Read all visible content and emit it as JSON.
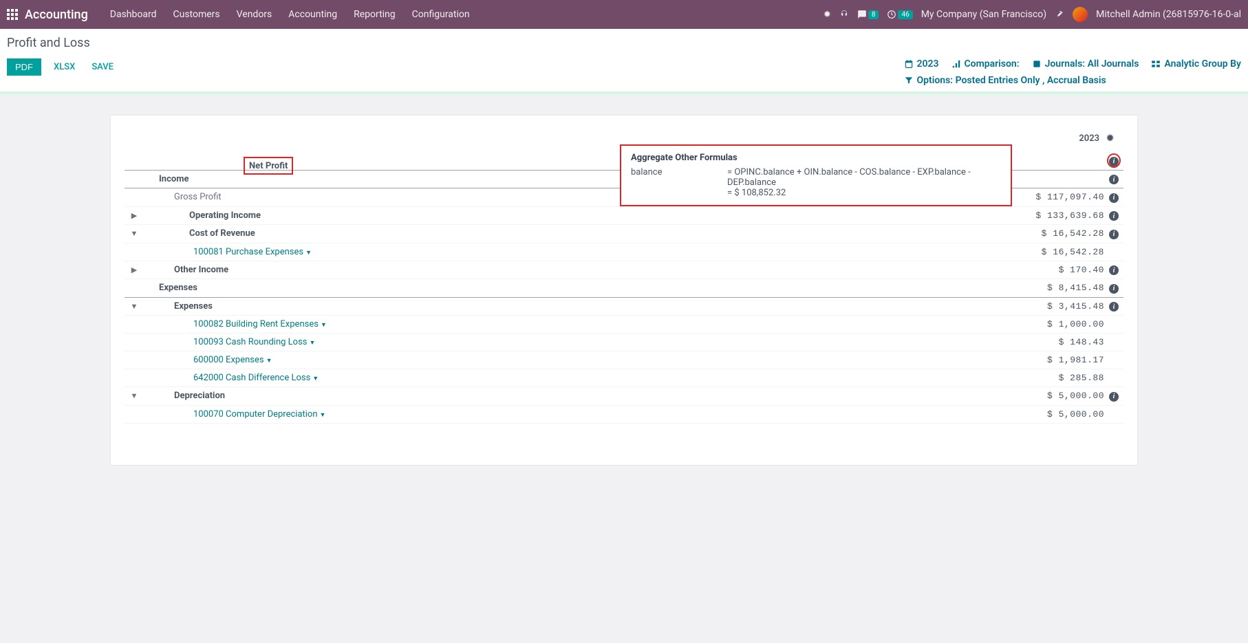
{
  "navbar": {
    "app_title": "Accounting",
    "menu": [
      "Dashboard",
      "Customers",
      "Vendors",
      "Accounting",
      "Reporting",
      "Configuration"
    ],
    "msg_badge": "8",
    "clock_badge": "46",
    "company": "My Company (San Francisco)",
    "user": "Mitchell Admin (26815976-16-0-al"
  },
  "header": {
    "title": "Profit and Loss",
    "buttons": {
      "pdf": "PDF",
      "xlsx": "XLSX",
      "save": "SAVE"
    },
    "filters": {
      "year": "2023",
      "comparison": "Comparison:",
      "journals": "Journals: All Journals",
      "analytic": "Analytic Group By",
      "options": "Options: Posted Entries Only , Accrual Basis"
    }
  },
  "report": {
    "col_header": "2023",
    "net_profit": "Net Profit",
    "tooltip": {
      "title": "Aggregate Other Formulas",
      "label": "balance",
      "formula": "= OPINC.balance + OIN.balance - COS.balance - EXP.balance - DEP.balance",
      "result": "= $ 108,852.32"
    },
    "rows": {
      "income": {
        "label": "Income",
        "value": ""
      },
      "gross_profit": {
        "label": "Gross Profit",
        "value": "$ 117,097.40"
      },
      "operating_income": {
        "label": "Operating Income",
        "value": "$ 133,639.68"
      },
      "cost_of_revenue": {
        "label": "Cost of Revenue",
        "value": "$ 16,542.28"
      },
      "purchase_exp": {
        "label": "100081 Purchase Expenses",
        "value": "$ 16,542.28"
      },
      "other_income": {
        "label": "Other Income",
        "value": "$ 170.40"
      },
      "expenses_top": {
        "label": "Expenses",
        "value": "$ 8,415.48"
      },
      "expenses": {
        "label": "Expenses",
        "value": "$ 3,415.48"
      },
      "building_rent": {
        "label": "100082 Building Rent Expenses",
        "value": "$ 1,000.00"
      },
      "cash_rounding": {
        "label": "100093 Cash Rounding Loss",
        "value": "$ 148.43"
      },
      "expenses_600": {
        "label": "600000 Expenses",
        "value": "$ 1,981.17"
      },
      "cash_diff": {
        "label": "642000 Cash Difference Loss",
        "value": "$ 285.88"
      },
      "depreciation": {
        "label": "Depreciation",
        "value": "$ 5,000.00"
      },
      "computer_dep": {
        "label": "100070 Computer Depreciation",
        "value": "$ 5,000.00"
      }
    }
  }
}
